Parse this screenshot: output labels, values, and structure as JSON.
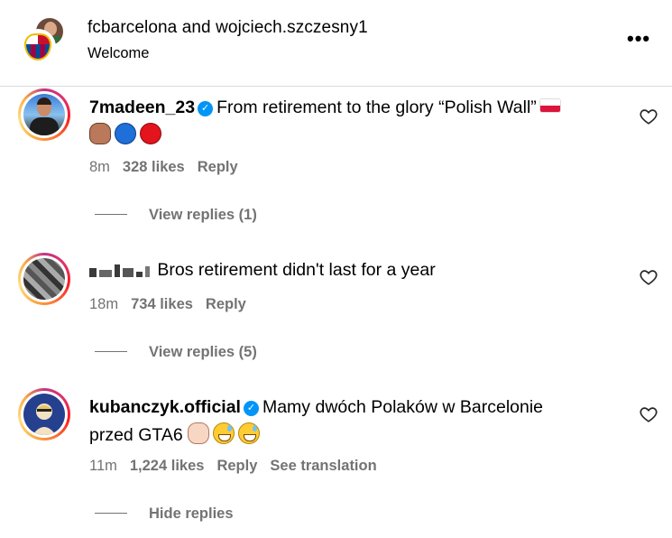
{
  "header": {
    "title": "fcbarcelona and wojciech.szczesny1",
    "subtitle": "Welcome",
    "more_label": "•••"
  },
  "comments": [
    {
      "username": "7madeen_23",
      "verified": true,
      "text": "From retirement to the glory “Polish Wall”",
      "time": "8m",
      "likes": "328 likes",
      "reply_label": "Reply",
      "replies_label": "View replies (1)"
    },
    {
      "username": "",
      "verified": false,
      "text": "Bros retirement didn't last for a year",
      "time": "18m",
      "likes": "734 likes",
      "reply_label": "Reply",
      "replies_label": "View replies (5)"
    },
    {
      "username": "kubanczyk.official",
      "verified": true,
      "text": "Mamy dwóch Polaków w Barcelonie",
      "text_line2": "przed GTA6",
      "time": "11m",
      "likes": "1,224 likes",
      "reply_label": "Reply",
      "translate_label": "See translation",
      "replies_label": "Hide replies"
    }
  ],
  "colors": {
    "verified_badge": "#0095f6",
    "meta_text": "#737373",
    "story_ring": "#e1306c"
  },
  "icons": {
    "more": "more-horizontal-icon",
    "like": "heart-outline-icon",
    "verified": "verified-badge-icon"
  }
}
